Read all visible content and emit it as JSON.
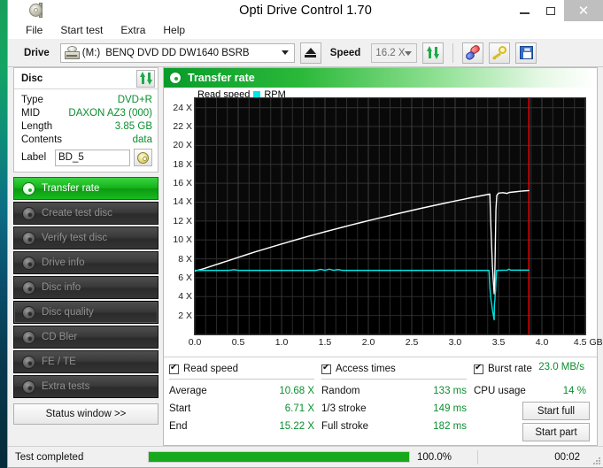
{
  "window": {
    "title": "Opti Drive Control 1.70",
    "app_icon": "disc-icon",
    "minimize": "–",
    "maximize": "□",
    "close": "✕"
  },
  "menu": {
    "items": [
      "File",
      "Start test",
      "Extra",
      "Help"
    ]
  },
  "toolbar": {
    "drive_label": "Drive",
    "drive_letter": "(M:)",
    "drive_name": "BENQ DVD DD DW1640 BSRB",
    "eject_icon": "eject-icon",
    "speed_label": "Speed",
    "speed_value": "16.2 X",
    "refresh_icon": "refresh-arrows-icon",
    "pill_icon": "pills-icon",
    "key_icon": "key-icon",
    "save_icon": "save-floppy-icon"
  },
  "disc": {
    "header": "Disc",
    "refresh_icon": "refresh-arrows-icon",
    "fields": [
      {
        "key": "Type",
        "value": "DVD+R"
      },
      {
        "key": "MID",
        "value": "DAXON AZ3 (000)"
      },
      {
        "key": "Length",
        "value": "3.85 GB"
      },
      {
        "key": "Contents",
        "value": "data"
      }
    ],
    "label_key": "Label",
    "label_value": "BD_5",
    "label_placeholder": "",
    "label_button_icon": "cd-icon"
  },
  "nav": {
    "items": [
      {
        "label": "Transfer rate",
        "state": "active"
      },
      {
        "label": "Create test disc",
        "state": "normal"
      },
      {
        "label": "Verify test disc",
        "state": "normal"
      },
      {
        "label": "Drive info",
        "state": "normal"
      },
      {
        "label": "Disc info",
        "state": "normal"
      },
      {
        "label": "Disc quality",
        "state": "selected"
      },
      {
        "label": "CD Bler",
        "state": "normal"
      },
      {
        "label": "FE / TE",
        "state": "normal"
      },
      {
        "label": "Extra tests",
        "state": "normal"
      }
    ],
    "status_window_button": "Status window >>"
  },
  "panel": {
    "title": "Transfer rate",
    "icon": "disc-icon"
  },
  "chart_data": {
    "type": "line",
    "title": "Transfer rate",
    "xlabel": "GB",
    "ylabel": "X",
    "xlim": [
      0.0,
      4.5
    ],
    "ylim": [
      0,
      25
    ],
    "grid": true,
    "background": "#000000",
    "legend_position": "top-left",
    "xticks": [
      "0.0",
      "0.5",
      "1.0",
      "1.5",
      "2.0",
      "2.5",
      "3.0",
      "3.5",
      "4.0",
      "4.5"
    ],
    "xtick_values": [
      0.0,
      0.5,
      1.0,
      1.5,
      2.0,
      2.5,
      3.0,
      3.5,
      4.0,
      4.5
    ],
    "xunit": "GB",
    "yticks": [
      "2 X",
      "4 X",
      "6 X",
      "8 X",
      "10 X",
      "12 X",
      "14 X",
      "16 X",
      "18 X",
      "20 X",
      "22 X",
      "24 X"
    ],
    "ytick_values": [
      2,
      4,
      6,
      8,
      10,
      12,
      14,
      16,
      18,
      20,
      22,
      24
    ],
    "markers": [
      {
        "name": "disc-end-marker",
        "x": 3.85,
        "color": "#ff0000"
      }
    ],
    "series": [
      {
        "name": "Read speed",
        "color": "#ffffff",
        "points": [
          [
            0.0,
            6.71
          ],
          [
            0.1,
            6.95
          ],
          [
            0.2,
            7.25
          ],
          [
            0.3,
            7.55
          ],
          [
            0.4,
            7.85
          ],
          [
            0.5,
            8.15
          ],
          [
            0.6,
            8.45
          ],
          [
            0.7,
            8.75
          ],
          [
            0.8,
            9.02
          ],
          [
            0.9,
            9.3
          ],
          [
            1.0,
            9.57
          ],
          [
            1.1,
            9.84
          ],
          [
            1.2,
            10.1
          ],
          [
            1.3,
            10.36
          ],
          [
            1.4,
            10.61
          ],
          [
            1.5,
            10.86
          ],
          [
            1.6,
            11.1
          ],
          [
            1.7,
            11.34
          ],
          [
            1.8,
            11.58
          ],
          [
            1.9,
            11.81
          ],
          [
            2.0,
            12.04
          ],
          [
            2.1,
            12.26
          ],
          [
            2.2,
            12.48
          ],
          [
            2.3,
            12.7
          ],
          [
            2.4,
            12.91
          ],
          [
            2.5,
            13.12
          ],
          [
            2.6,
            13.33
          ],
          [
            2.7,
            13.53
          ],
          [
            2.8,
            13.73
          ],
          [
            2.9,
            13.93
          ],
          [
            3.0,
            14.12
          ],
          [
            3.1,
            14.31
          ],
          [
            3.2,
            14.5
          ],
          [
            3.3,
            14.68
          ],
          [
            3.38,
            14.82
          ],
          [
            3.4,
            14.85
          ],
          [
            3.41,
            12.0
          ],
          [
            3.42,
            9.5
          ],
          [
            3.43,
            7.2
          ],
          [
            3.44,
            5.6
          ],
          [
            3.45,
            4.3
          ],
          [
            3.455,
            5.2
          ],
          [
            3.46,
            7.8
          ],
          [
            3.465,
            10.5
          ],
          [
            3.47,
            13.2
          ],
          [
            3.48,
            14.7
          ],
          [
            3.5,
            14.95
          ],
          [
            3.55,
            15.0
          ],
          [
            3.6,
            14.92
          ],
          [
            3.62,
            15.02
          ],
          [
            3.65,
            15.05
          ],
          [
            3.7,
            15.1
          ],
          [
            3.75,
            15.15
          ],
          [
            3.8,
            15.19
          ],
          [
            3.85,
            15.22
          ]
        ]
      },
      {
        "name": "RPM",
        "color": "#00e5e5",
        "points": [
          [
            0.0,
            6.78
          ],
          [
            0.4,
            6.78
          ],
          [
            0.45,
            6.85
          ],
          [
            0.5,
            6.78
          ],
          [
            1.4,
            6.78
          ],
          [
            1.45,
            6.88
          ],
          [
            1.5,
            6.78
          ],
          [
            1.55,
            6.9
          ],
          [
            1.6,
            6.78
          ],
          [
            1.65,
            6.86
          ],
          [
            1.7,
            6.78
          ],
          [
            3.39,
            6.78
          ],
          [
            3.4,
            5.0
          ],
          [
            3.41,
            3.9
          ],
          [
            3.42,
            3.3
          ],
          [
            3.43,
            2.6
          ],
          [
            3.44,
            2.05
          ],
          [
            3.45,
            1.55
          ],
          [
            3.452,
            3.0
          ],
          [
            3.455,
            3.45
          ],
          [
            3.458,
            3.55
          ],
          [
            3.462,
            4.3
          ],
          [
            3.466,
            4.55
          ],
          [
            3.47,
            5.5
          ],
          [
            3.474,
            6.1
          ],
          [
            3.478,
            6.78
          ],
          [
            3.6,
            6.8
          ],
          [
            3.62,
            6.9
          ],
          [
            3.64,
            6.8
          ],
          [
            3.85,
            6.8
          ]
        ]
      }
    ],
    "legend": [
      {
        "label": "Read speed",
        "color": "#000000",
        "swatch": false
      },
      {
        "label": "RPM",
        "color": "#00e5e5",
        "swatch": true
      }
    ]
  },
  "results": {
    "read_speed": {
      "checkbox_label": "Read speed",
      "checked": true,
      "rows": [
        {
          "key": "Average",
          "value": "10.68 X"
        },
        {
          "key": "Start",
          "value": "6.71 X"
        },
        {
          "key": "End",
          "value": "15.22 X"
        }
      ]
    },
    "access_times": {
      "checkbox_label": "Access times",
      "checked": true,
      "rows": [
        {
          "key": "Random",
          "value": "133 ms"
        },
        {
          "key": "1/3 stroke",
          "value": "149 ms"
        },
        {
          "key": "Full stroke",
          "value": "182 ms"
        }
      ]
    },
    "burst_rate": {
      "checkbox_label": "Burst rate",
      "checked": true,
      "value": "23.0 MB/s",
      "cpu_key": "CPU usage",
      "cpu_value": "14 %"
    },
    "buttons": [
      {
        "label": "Start full"
      },
      {
        "label": "Start part"
      }
    ]
  },
  "statusbar": {
    "text": "Test completed",
    "progress_percent": "100.0%",
    "progress_value": 100,
    "elapsed": "00:02"
  }
}
